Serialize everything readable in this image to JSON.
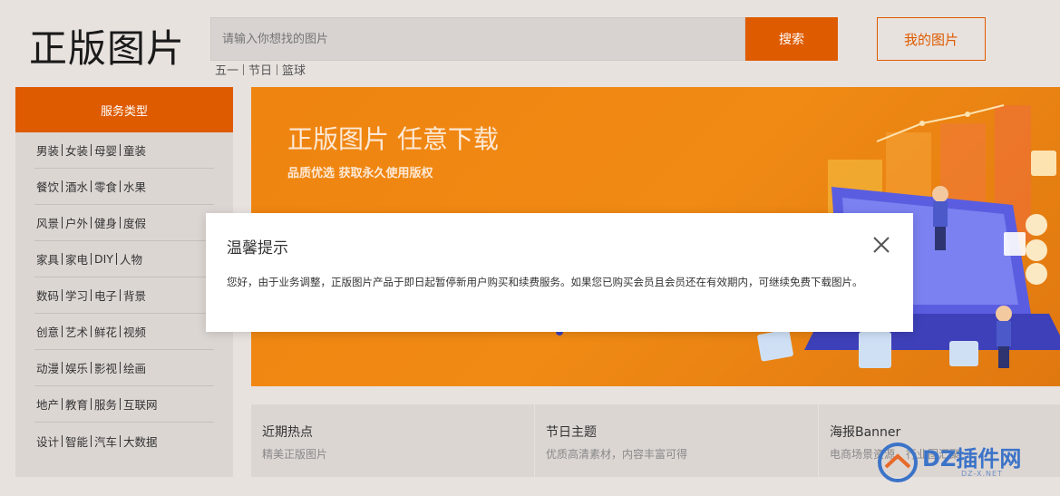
{
  "header": {
    "logo": "正版图片",
    "search_placeholder": "请输入你想找的图片",
    "search_button": "搜索",
    "my_pics_button": "我的图片",
    "hot_words": [
      "五一",
      "节日",
      "篮球"
    ]
  },
  "sidebar": {
    "title": "服务类型",
    "rows": [
      [
        "男装",
        "女装",
        "母婴",
        "童装"
      ],
      [
        "餐饮",
        "酒水",
        "零食",
        "水果"
      ],
      [
        "风景",
        "户外",
        "健身",
        "度假"
      ],
      [
        "家具",
        "家电",
        "DIY",
        "人物"
      ],
      [
        "数码",
        "学习",
        "电子",
        "背景"
      ],
      [
        "创意",
        "艺术",
        "鲜花",
        "视频"
      ],
      [
        "动漫",
        "娱乐",
        "影视",
        "绘画"
      ],
      [
        "地产",
        "教育",
        "服务",
        "互联网"
      ],
      [
        "设计",
        "智能",
        "汽车",
        "大数据"
      ]
    ]
  },
  "banner": {
    "title": "正版图片 任意下载",
    "subtitle": "品质优选 获取永久使用版权"
  },
  "cards": [
    {
      "title": "近期热点",
      "desc": "精美正版图片"
    },
    {
      "title": "节日主题",
      "desc": "优质高清素材，内容丰富可得"
    },
    {
      "title": "海报Banner",
      "desc": "电商场景资源，行业图汇聚"
    }
  ],
  "modal": {
    "title": "温馨提示",
    "message": "您好，由于业务调整，正版图片产品于即日起暂停新用户购买和续费服务。如果您已购买会员且会员还在有效期内，可继续免费下载图片。"
  },
  "watermark": {
    "text": "DZ插件网",
    "url": "DZ-X.NET"
  },
  "colors": {
    "accent": "#de5b00",
    "banner": "#ef8410",
    "background": "#e8e2df"
  }
}
